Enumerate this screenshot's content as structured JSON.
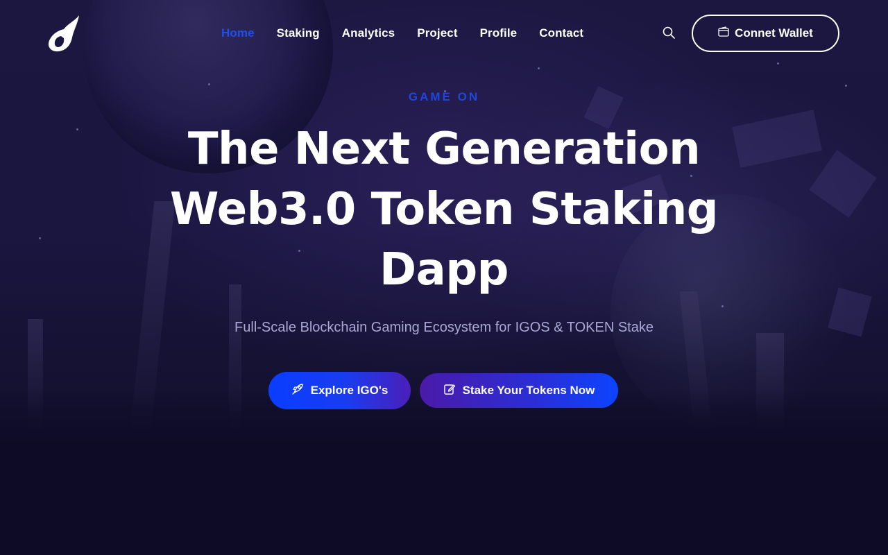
{
  "nav": {
    "items": [
      {
        "label": "Home",
        "active": true
      },
      {
        "label": "Staking",
        "active": false
      },
      {
        "label": "Analytics",
        "active": false
      },
      {
        "label": "Project",
        "active": false
      },
      {
        "label": "Profile",
        "active": false
      },
      {
        "label": "Contact",
        "active": false
      }
    ],
    "wallet_button": "Connet Wallet",
    "search_icon": "search-icon",
    "logo_icon": "flame-logo-icon"
  },
  "hero": {
    "eyebrow": "GAME ON",
    "headline_line1": "The Next Generation",
    "headline_line2": "Web3.0 Token Staking",
    "headline_line3": "Dapp",
    "subtitle": "Full-Scale Blockchain Gaming Ecosystem for IGOS & TOKEN Stake",
    "primary_cta": "Explore IGO's",
    "secondary_cta": "Stake Your Tokens Now"
  },
  "colors": {
    "accent": "#1f47e0",
    "background": "#0d0b26",
    "subtitle": "#a9a8d6"
  }
}
